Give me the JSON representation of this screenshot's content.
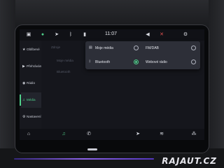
{
  "statusbar": {
    "time": "11:07",
    "icons": [
      "car-icon",
      "spotify-icon",
      "navigation-icon",
      "bluetooth-icon",
      "phone-icon",
      "volume-icon",
      "mute-icon",
      "settings-icon"
    ]
  },
  "sidebar": {
    "items": [
      {
        "label": "Oblíbené",
        "icon": "star-icon"
      },
      {
        "label": "Přehrávání",
        "icon": "play-icon"
      },
      {
        "label": "Rádio",
        "icon": "radio-icon"
      },
      {
        "label": "Média",
        "icon": "media-icon",
        "active": true
      },
      {
        "label": "Nastavení",
        "icon": "gear-icon"
      }
    ]
  },
  "background_content": {
    "heading": "Zdroje",
    "rows": [
      "Moje média",
      "Bluetooth"
    ]
  },
  "source_popup": {
    "options": [
      {
        "label": "Moje média",
        "icon": "media-icon",
        "selected": false
      },
      {
        "label": "FM/DAB",
        "selected": false
      },
      {
        "label": "Bluetooth",
        "icon": "bluetooth-icon",
        "selected": true
      },
      {
        "label": "Webové rádio",
        "selected": false
      }
    ]
  },
  "bottombar": {
    "icons": [
      "home-icon",
      "music-icon",
      "phone-icon",
      "navigation-icon",
      "climate-icon",
      "apps-icon"
    ]
  },
  "colors": {
    "accent": "#4fd08a",
    "panel": "#2d2f38",
    "background": "#14151a"
  },
  "watermark": "RAJAUT.CZ"
}
